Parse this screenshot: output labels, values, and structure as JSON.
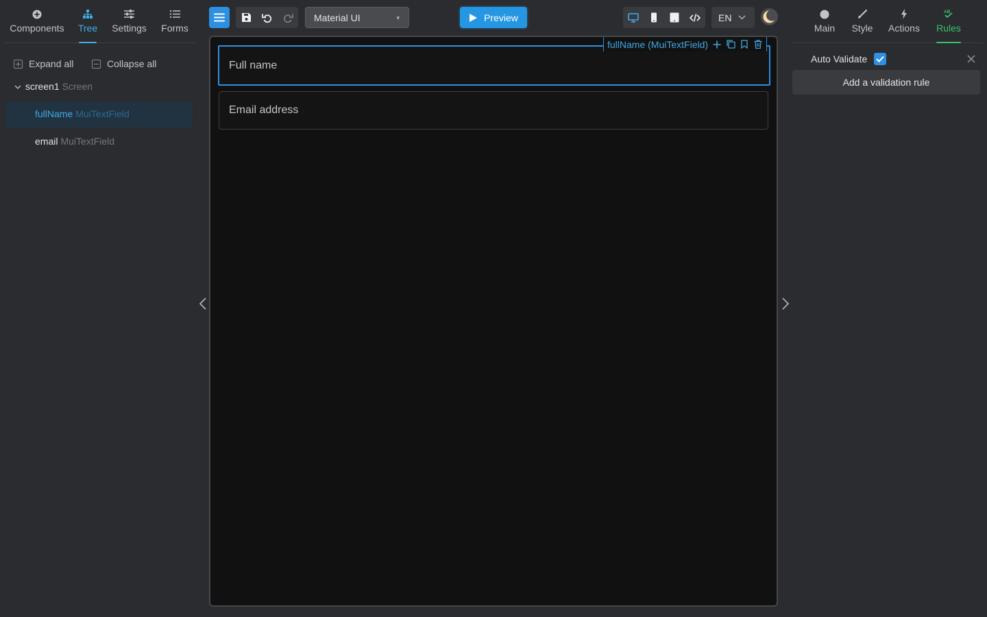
{
  "left_panel": {
    "tabs": [
      {
        "label": "Components",
        "icon": "plus-circle-icon"
      },
      {
        "label": "Tree",
        "icon": "hierarchy-icon",
        "active": true
      },
      {
        "label": "Settings",
        "icon": "sliders-icon"
      },
      {
        "label": "Forms",
        "icon": "list-icon"
      }
    ],
    "expand_all": "Expand all",
    "collapse_all": "Collapse all",
    "tree": {
      "root": {
        "name": "screen1",
        "type": "Screen",
        "expanded": true
      },
      "children": [
        {
          "name": "fullName",
          "type": "MuiTextField",
          "selected": true
        },
        {
          "name": "email",
          "type": "MuiTextField",
          "selected": false
        }
      ]
    }
  },
  "toolbar": {
    "menu_icon": "hamburger-icon",
    "save_icon": "save-icon",
    "undo_icon": "undo-icon",
    "redo_icon": "redo-icon",
    "library": {
      "value": "Material UI"
    },
    "preview_label": "Preview",
    "devices": [
      "desktop-icon",
      "mobile-icon",
      "tablet-icon",
      "code-icon"
    ],
    "language": "EN",
    "theme_icon": "moon-icon"
  },
  "canvas": {
    "selected_component": "fullName (MuiTextField)",
    "fields": [
      {
        "label": "Full name",
        "selected": true
      },
      {
        "label": "Email address",
        "selected": false
      }
    ]
  },
  "right_panel": {
    "tabs": [
      {
        "label": "Main",
        "icon": "circle-icon"
      },
      {
        "label": "Style",
        "icon": "brush-icon"
      },
      {
        "label": "Actions",
        "icon": "bolt-icon"
      },
      {
        "label": "Rules",
        "icon": "ab-check-icon",
        "active": true
      }
    ],
    "auto_validate_label": "Auto Validate",
    "auto_validate_checked": true,
    "add_rule_label": "Add a validation rule"
  },
  "colors": {
    "accent_blue": "#2f8fe0",
    "tab_blue": "#3fb0ea",
    "rules_green": "#35c46a",
    "background": "#2b2c2f",
    "canvas": "#111111"
  }
}
